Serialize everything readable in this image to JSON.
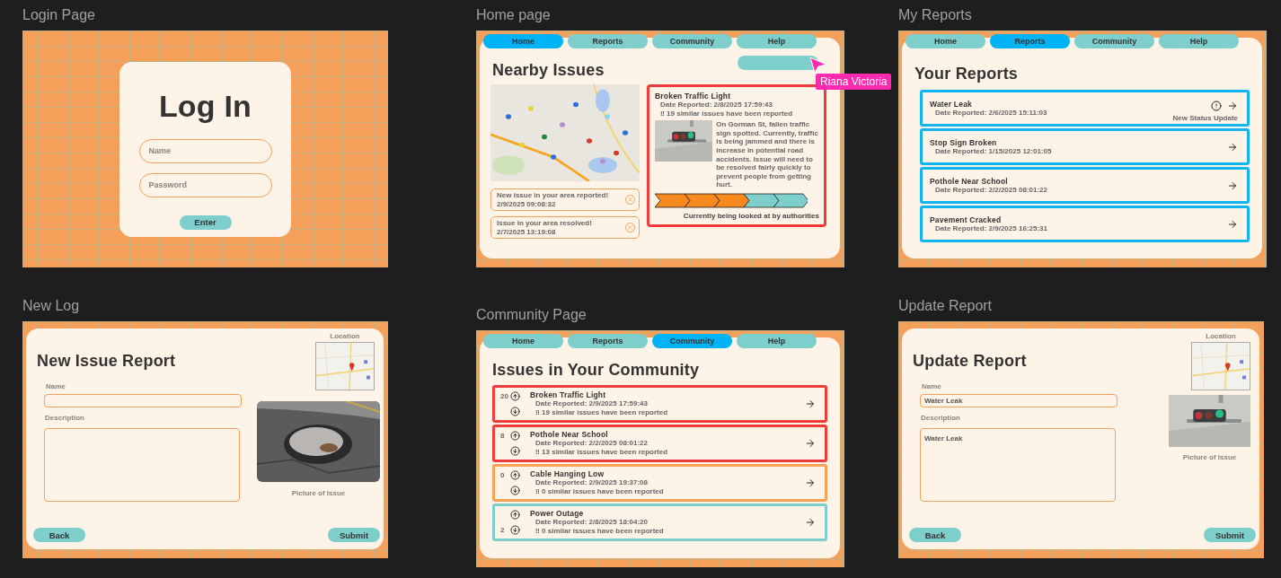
{
  "frames": [
    {
      "kind": "login",
      "label": "Login Page",
      "title": "Log In",
      "fields": [
        {
          "placeholder": "Name"
        },
        {
          "placeholder": "Password"
        }
      ],
      "button": "Enter"
    },
    {
      "kind": "home",
      "label": "Home page",
      "nav": [
        {
          "label": "Home",
          "selected": true
        },
        {
          "label": "Reports",
          "selected": false
        },
        {
          "label": "Community",
          "selected": false
        },
        {
          "label": "Help",
          "selected": false
        }
      ],
      "title": "Nearby Issues",
      "notifications": [
        {
          "text": "New issue in your area reported!",
          "time": "2/9/2025 09:08:32"
        },
        {
          "text": "Issue in your area resolved!",
          "time": "2/7/2025 13:19:08"
        }
      ],
      "issue": {
        "title": "Broken Traffic Light",
        "date": "Date Reported: 2/8/2025 17:59:43",
        "similar": "‼ 19 similar issues have been reported",
        "description": "On Gorman St, fallen traffic sign spotted. Currently, traffic is being jammed and there is increase in potential road accidents. Issue will need to be resolved fairly quickly to prevent people from getting hurt.",
        "progress": {
          "level": 0.6
        },
        "status": "Currently being looked at by authorities"
      }
    },
    {
      "kind": "reports",
      "label": "My Reports",
      "nav": [
        {
          "label": "Home",
          "selected": false
        },
        {
          "label": "Reports",
          "selected": true
        },
        {
          "label": "Community",
          "selected": false
        },
        {
          "label": "Help",
          "selected": false
        }
      ],
      "title": "Your Reports",
      "reports": [
        {
          "title": "Water Leak",
          "date": "Date Reported: 2/6/2025 15:11:03",
          "status": "New Status Update"
        },
        {
          "title": "Stop Sign Broken",
          "date": "Date Reported: 1/15/2025 12:01:05"
        },
        {
          "title": "Pothole Near School",
          "date": "Date Reported: 2/2/2025 08:01:22"
        },
        {
          "title": "Pavement Cracked",
          "date": "Date Reported: 2/9/2025 16:25:31"
        }
      ]
    },
    {
      "kind": "form",
      "label": "New Log",
      "title": "New Issue Report",
      "location_label": "Location",
      "name_label": "Name",
      "description_label": "Description",
      "caption": "Picture of Issue",
      "buttons": [
        "Back",
        "Submit"
      ]
    },
    {
      "kind": "community",
      "label": "Community Page",
      "nav": [
        {
          "label": "Home",
          "selected": false
        },
        {
          "label": "Reports",
          "selected": false
        },
        {
          "label": "Community",
          "selected": true
        },
        {
          "label": "Help",
          "selected": false
        }
      ],
      "title": "Issues in Your Community",
      "issues": [
        {
          "votes": "20",
          "title": "Broken Traffic Light",
          "date": "Date Reported: 2/9/2025 17:59:43",
          "similar": "‼ 19 similar issues have been reported",
          "color": "#ef3b3b"
        },
        {
          "votes": "8",
          "title": "Pothole Near School",
          "date": "Date Reported: 2/2/2025 08:01:22",
          "similar": "‼ 13 similar issues have been reported",
          "color": "#ef3b3b"
        },
        {
          "votes": "0",
          "title": "Cable Hanging Low",
          "date": "Date Reported: 2/9/2025 19:37:08",
          "similar": "‼ 0 similar issues have been reported",
          "color": "#f7a255"
        },
        {
          "votes": "2",
          "title": "Power Outage",
          "date": "Date Reported: 2/8/2025 18:04:20",
          "similar": "‼ 0 similar issues have been reported",
          "color": "#7ecfcc"
        }
      ]
    },
    {
      "kind": "form",
      "label": "Update Report",
      "title": "Update Report",
      "location_label": "Location",
      "name_label": "Name",
      "name_value": "Water Leak",
      "description_label": "Description",
      "description_value": "Water Leak",
      "caption": "Picture of Issue",
      "buttons": [
        "Back",
        "Submit"
      ]
    }
  ],
  "cursor": {
    "name": "Riana Victoria"
  }
}
